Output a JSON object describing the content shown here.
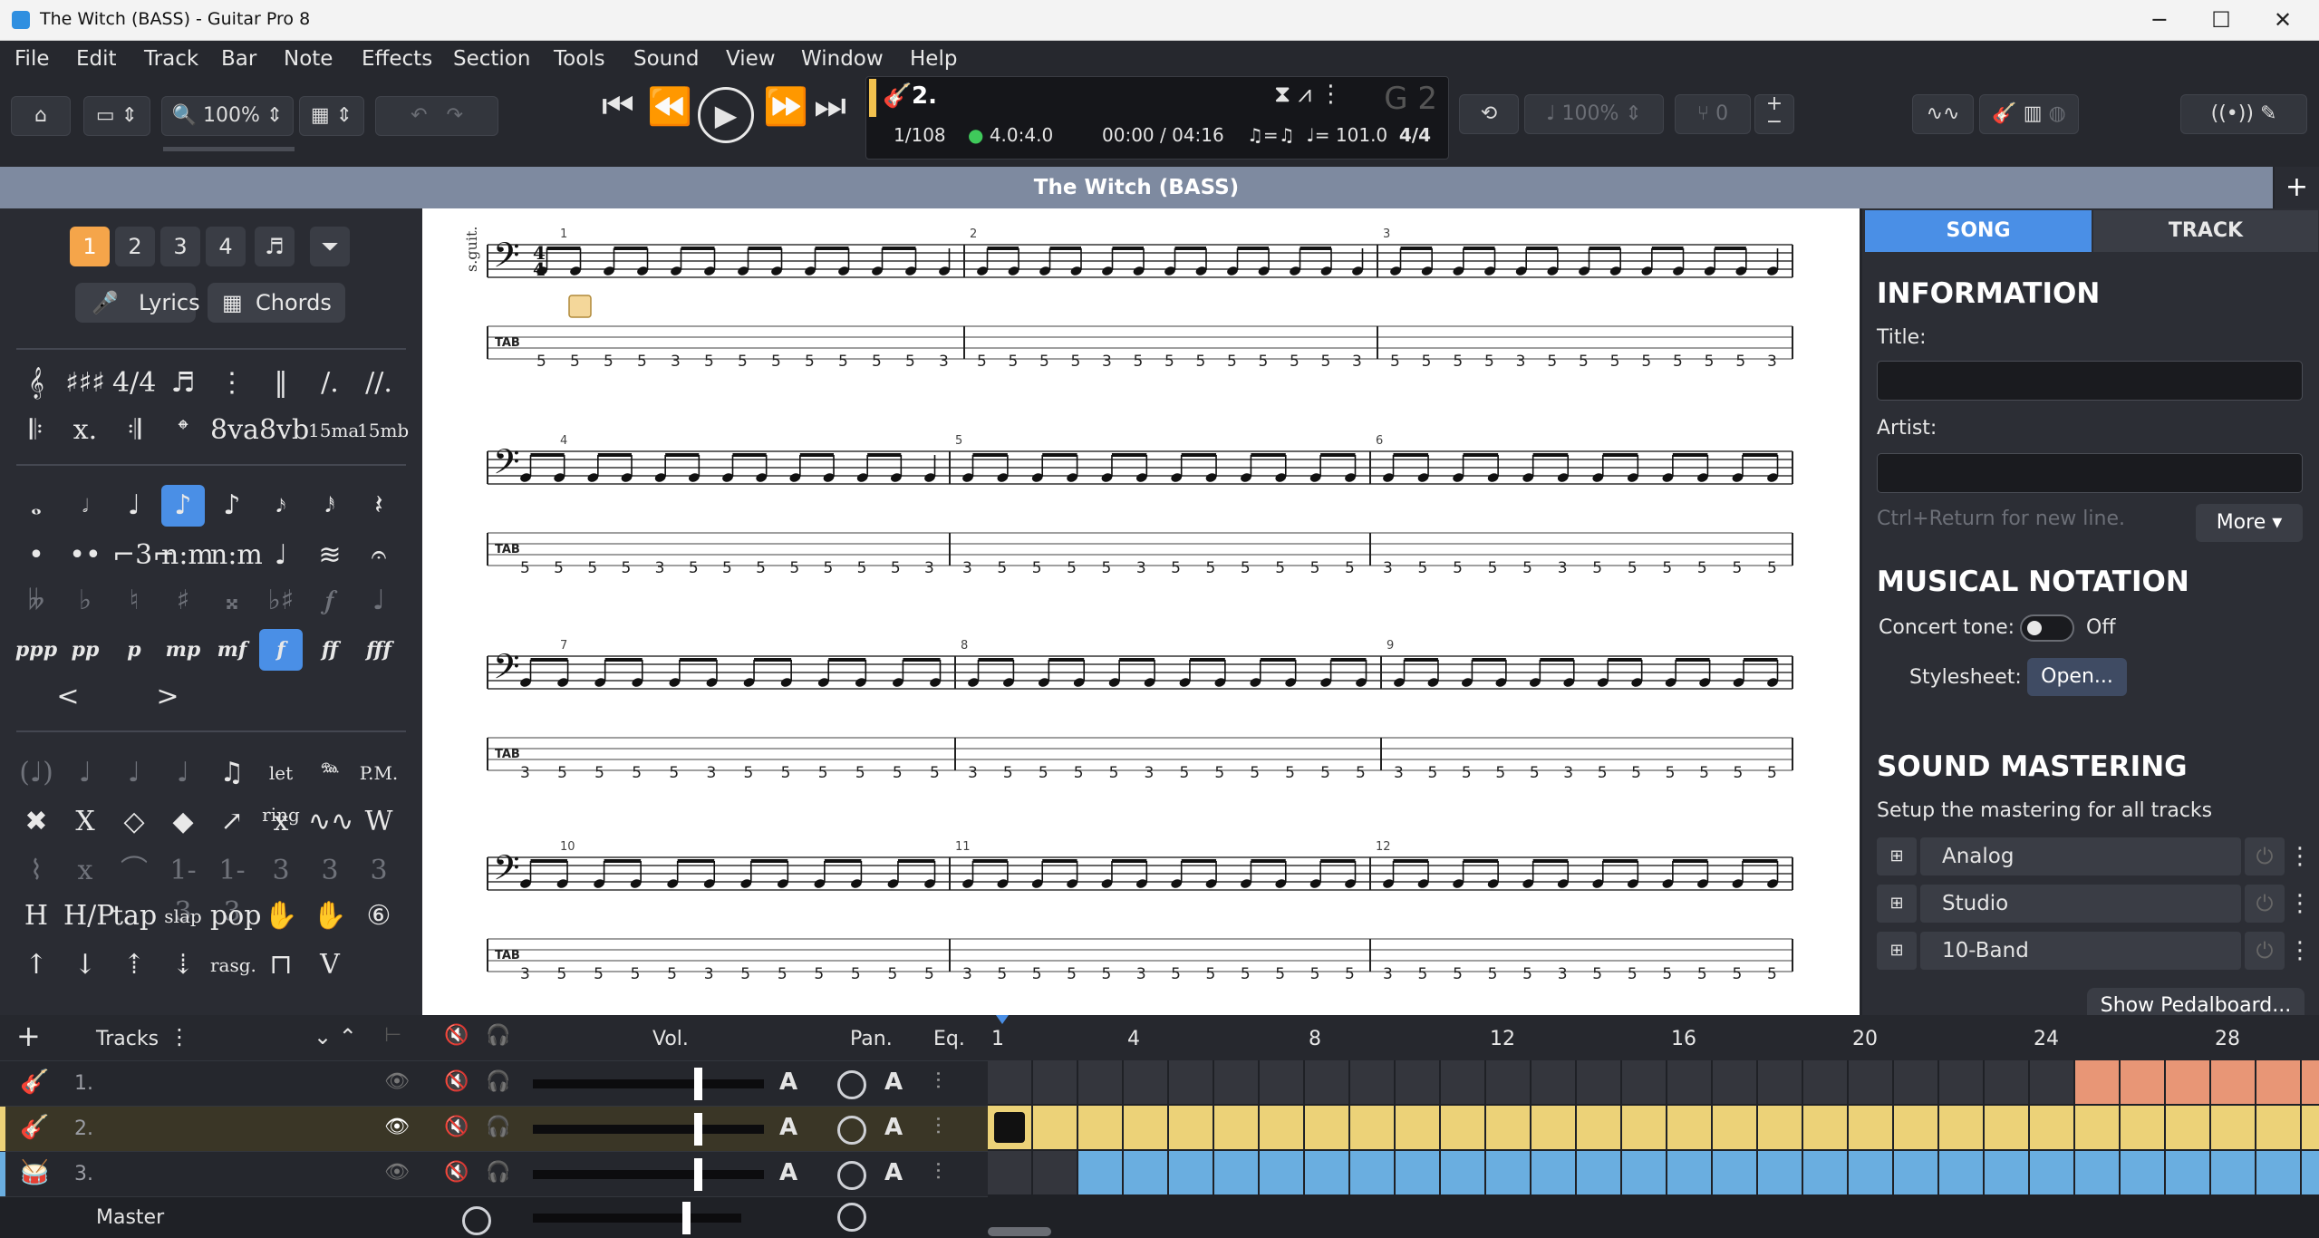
{
  "window": {
    "title": "The Witch (BASS) - Guitar Pro 8"
  },
  "menu": [
    "File",
    "Edit",
    "Track",
    "Bar",
    "Note",
    "Effects",
    "Section",
    "Tools",
    "Sound",
    "View",
    "Window",
    "Help"
  ],
  "toolbar": {
    "zoom": "100%",
    "speed": "100%",
    "tuning_offset": "0"
  },
  "lcd": {
    "track": "2.",
    "bar": "1/108",
    "signature": "4.0:4.0",
    "time": "00:00 / 04:16",
    "tempo": "= 101.0",
    "swing": "♫=♫",
    "g2": "G 2"
  },
  "document": {
    "tab_title": "The Witch (BASS)",
    "plus": "+"
  },
  "palette": {
    "voices": [
      "1",
      "2",
      "3",
      "4"
    ],
    "lyrics": "Lyrics",
    "chords": "Chords",
    "row_clefs": [
      "𝄞",
      "♯♯♯",
      "4/4",
      "♬",
      "⋮",
      "‖",
      "∕.",
      "∕∕."
    ],
    "row_repeats": [
      "𝄆",
      "x.",
      "𝄇",
      "𝄌",
      "8va",
      "8vb",
      "15ma",
      "15mb"
    ],
    "row_notes": [
      "𝅝",
      "𝅗𝅥",
      "♩",
      "♪",
      "♪",
      "𝅘𝅥𝅯",
      "𝅘𝅥𝅰",
      "𝄽"
    ],
    "row_dots": [
      "•",
      "••",
      "⌐3⌐",
      "n:m",
      "n:m",
      "♩",
      "≋",
      "𝄐"
    ],
    "row_acc": [
      "𝄫",
      "♭",
      "♮",
      "♯",
      "𝄪",
      "♭♯",
      "𝆑",
      "♩"
    ],
    "row_dyn": [
      "ppp",
      "pp",
      "p",
      "mp",
      "mf",
      "f",
      "ff",
      "fff"
    ],
    "row_hair": [
      "<",
      ">"
    ],
    "row_fx1": [
      "(♩)",
      "♩",
      "♩",
      "♩",
      "♫",
      "let ring",
      "𝆮",
      "P.M."
    ],
    "row_fx2": [
      "✖",
      "X",
      "◇",
      "◆",
      "↗",
      "x",
      "∿∿",
      "W"
    ],
    "row_fx3": [
      "⌇",
      "x",
      "⌒",
      "1-3",
      "1-3",
      "3",
      "3",
      "3"
    ],
    "row_fx4": [
      "H",
      "H/P",
      "tap",
      "slap",
      "pop",
      "✋",
      "✋",
      "⑥"
    ],
    "row_fx5": [
      "↑",
      "↓",
      "⇡",
      "⇣",
      "rasg.",
      "⊓",
      "V"
    ]
  },
  "score": {
    "staff_label": "s.guit.",
    "clef": "𝄢",
    "time_sig": "4/4",
    "tab_label": "TAB",
    "systems": [
      {
        "bars": [
          "1",
          "2",
          "3"
        ],
        "frets": [
          [
            "5",
            "5",
            "5",
            "5",
            "3",
            "5",
            "5",
            "5",
            "5",
            "5",
            "5",
            "5",
            "3"
          ],
          [
            "5",
            "5",
            "5",
            "5",
            "3",
            "5",
            "5",
            "5",
            "5",
            "5",
            "5",
            "5",
            "3"
          ],
          [
            "5",
            "5",
            "5",
            "5",
            "3",
            "5",
            "5",
            "5",
            "5",
            "5",
            "5",
            "5",
            "3"
          ]
        ]
      },
      {
        "bars": [
          "4",
          "5",
          "6"
        ],
        "frets": [
          [
            "5",
            "5",
            "5",
            "5",
            "3",
            "5",
            "5",
            "5",
            "5",
            "5",
            "5",
            "5",
            "3"
          ],
          [
            "3",
            "5",
            "5",
            "5",
            "5",
            "3",
            "5",
            "5",
            "5",
            "5",
            "5",
            "5"
          ],
          [
            "3",
            "5",
            "5",
            "5",
            "5",
            "3",
            "5",
            "5",
            "5",
            "5",
            "5",
            "5"
          ]
        ]
      },
      {
        "bars": [
          "7",
          "8",
          "9"
        ],
        "frets": [
          [
            "3",
            "5",
            "5",
            "5",
            "5",
            "3",
            "5",
            "5",
            "5",
            "5",
            "5",
            "5"
          ],
          [
            "3",
            "5",
            "5",
            "5",
            "5",
            "3",
            "5",
            "5",
            "5",
            "5",
            "5",
            "5"
          ],
          [
            "3",
            "5",
            "5",
            "5",
            "5",
            "3",
            "5",
            "5",
            "5",
            "5",
            "5",
            "5"
          ]
        ]
      },
      {
        "bars": [
          "10",
          "11",
          "12"
        ],
        "frets": [
          [
            "3",
            "5",
            "5",
            "5",
            "5",
            "3",
            "5",
            "5",
            "5",
            "5",
            "5",
            "5"
          ],
          [
            "3",
            "5",
            "5",
            "5",
            "5",
            "3",
            "5",
            "5",
            "5",
            "5",
            "5",
            "5"
          ],
          [
            "3",
            "5",
            "5",
            "5",
            "5",
            "3",
            "5",
            "5",
            "5",
            "5",
            "5",
            "5"
          ]
        ]
      }
    ]
  },
  "panel": {
    "tabs": [
      "SONG",
      "TRACK"
    ],
    "information": "INFORMATION",
    "title_label": "Title:",
    "artist_label": "Artist:",
    "hint": "Ctrl+Return for new line.",
    "more": "More",
    "musical_notation": "MUSICAL NOTATION",
    "concert_tone": "Concert tone:",
    "off": "Off",
    "stylesheet": "Stylesheet:",
    "open": "Open...",
    "sound_mastering": "SOUND MASTERING",
    "mastering_hint": "Setup the mastering for all tracks",
    "mastering": [
      "Analog",
      "Studio",
      "10-Band"
    ],
    "pedalboard": "Show Pedalboard..."
  },
  "mixer": {
    "tracks_label": "Tracks",
    "vol": "Vol.",
    "pan": "Pan.",
    "eq": "Eq.",
    "tracks": [
      "1.",
      "2.",
      "3."
    ],
    "master": "Master",
    "timeline": [
      "1",
      "4",
      "8",
      "12",
      "16",
      "20",
      "24",
      "28"
    ]
  },
  "colors": {
    "accent": "#4a8fe6",
    "voice": "#f5a54a",
    "track1": "#e89676",
    "track2": "#ecd278",
    "track3": "#6aaee0"
  }
}
